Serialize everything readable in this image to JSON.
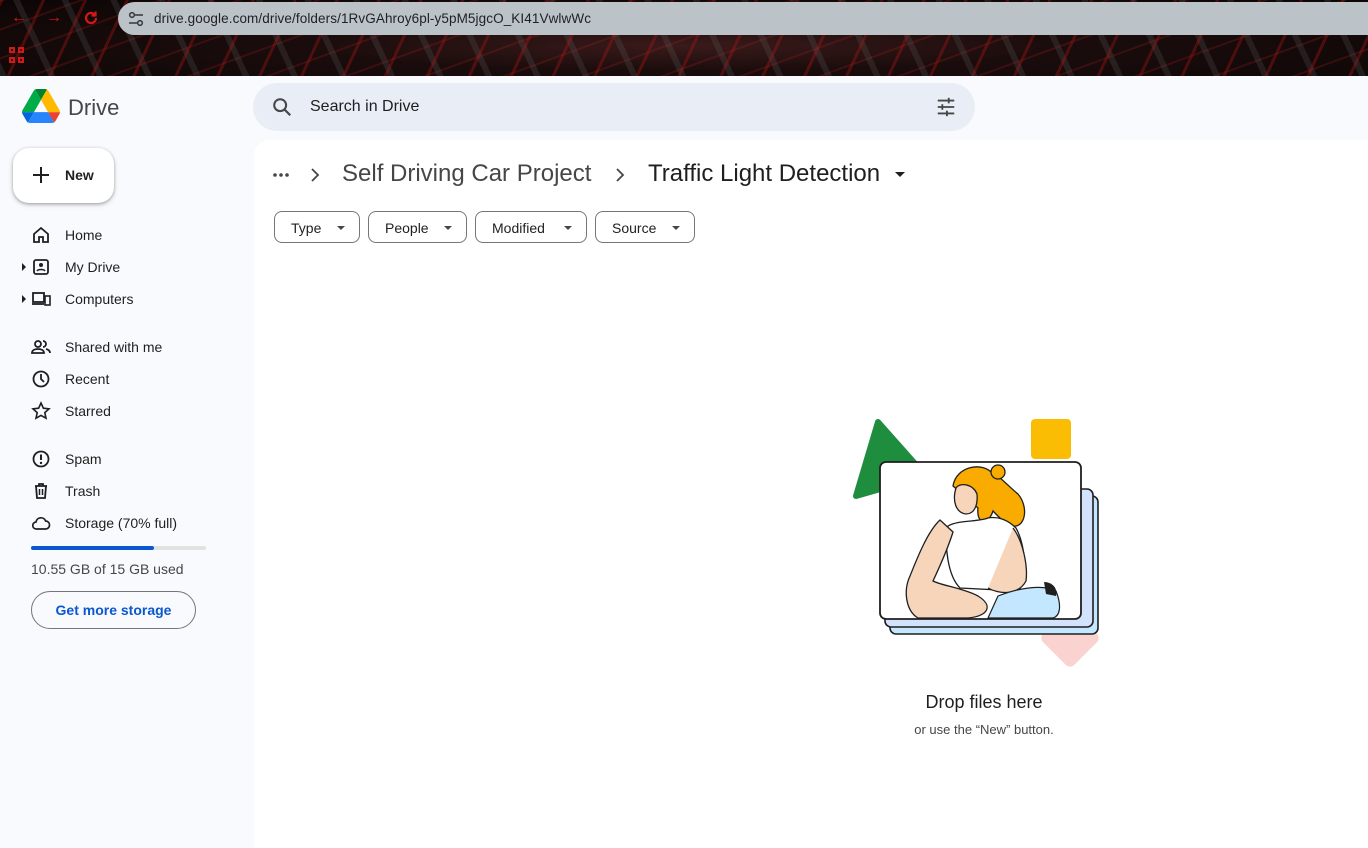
{
  "browser": {
    "url": "drive.google.com/drive/folders/1RvGAhroy6pl-y5pM5jgcO_KI41VwlwWc",
    "accent_color": "#d31818"
  },
  "app": {
    "name": "Drive",
    "search_placeholder": "Search in Drive"
  },
  "sidebar": {
    "new_label": "New",
    "items": [
      {
        "label": "Home",
        "icon": "home-icon"
      },
      {
        "label": "My Drive",
        "icon": "my-drive-icon"
      },
      {
        "label": "Computers",
        "icon": "computers-icon"
      },
      {
        "label": "Shared with me",
        "icon": "people-icon"
      },
      {
        "label": "Recent",
        "icon": "clock-icon"
      },
      {
        "label": "Starred",
        "icon": "star-icon"
      },
      {
        "label": "Spam",
        "icon": "spam-icon"
      },
      {
        "label": "Trash",
        "icon": "trash-icon"
      },
      {
        "label": "Storage (70% full)",
        "icon": "cloud-icon"
      }
    ],
    "storage": {
      "used_fraction": 0.7,
      "text": "10.55 GB of 15 GB used",
      "button_label": "Get more storage"
    }
  },
  "main": {
    "breadcrumb": {
      "parent": "Self Driving Car Project",
      "current": "Traffic Light Detection"
    },
    "filters": [
      "Type",
      "People",
      "Modified",
      "Source"
    ],
    "empty_state": {
      "title": "Drop files here",
      "subtitle": "or use the “New” button."
    }
  }
}
